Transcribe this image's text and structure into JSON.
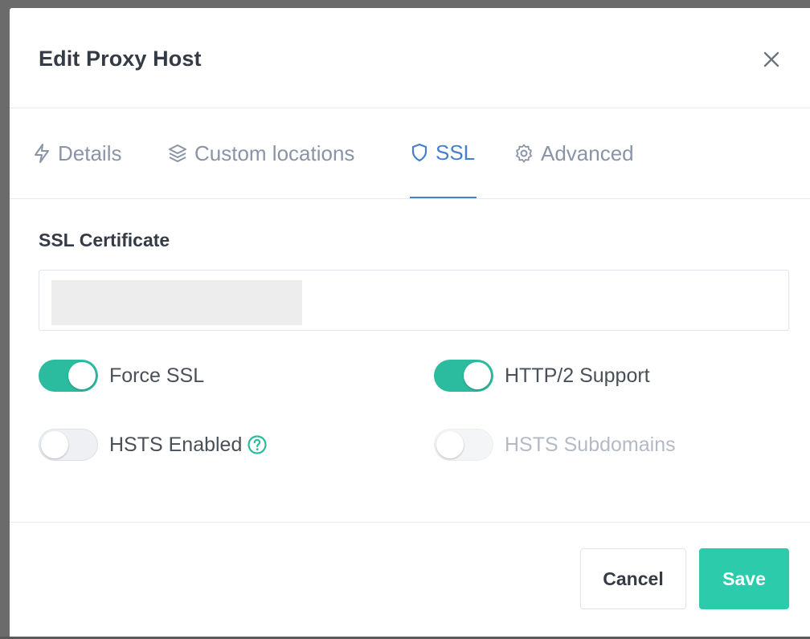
{
  "modal": {
    "title": "Edit Proxy Host",
    "close_icon": "close-icon"
  },
  "tabs": [
    {
      "label": "Details",
      "icon": "bolt-icon",
      "active": false
    },
    {
      "label": "Custom locations",
      "icon": "layers-icon",
      "active": false
    },
    {
      "label": "SSL",
      "icon": "shield-icon",
      "active": true
    },
    {
      "label": "Advanced",
      "icon": "gear-icon",
      "active": false
    }
  ],
  "ssl": {
    "certificate_label": "SSL Certificate",
    "certificate_value": "",
    "toggles": [
      {
        "label": "Force SSL",
        "on": true,
        "disabled": false
      },
      {
        "label": "HTTP/2 Support",
        "on": true,
        "disabled": false
      },
      {
        "label": "HSTS Enabled",
        "on": false,
        "disabled": false,
        "help_icon": "question-circle-icon"
      },
      {
        "label": "HSTS Subdomains",
        "on": false,
        "disabled": true
      }
    ]
  },
  "footer": {
    "cancel_label": "Cancel",
    "save_label": "Save"
  },
  "colors": {
    "accent_tab": "#467fcf",
    "toggle_on": "#2bbca0",
    "save_button": "#2bcbab"
  }
}
